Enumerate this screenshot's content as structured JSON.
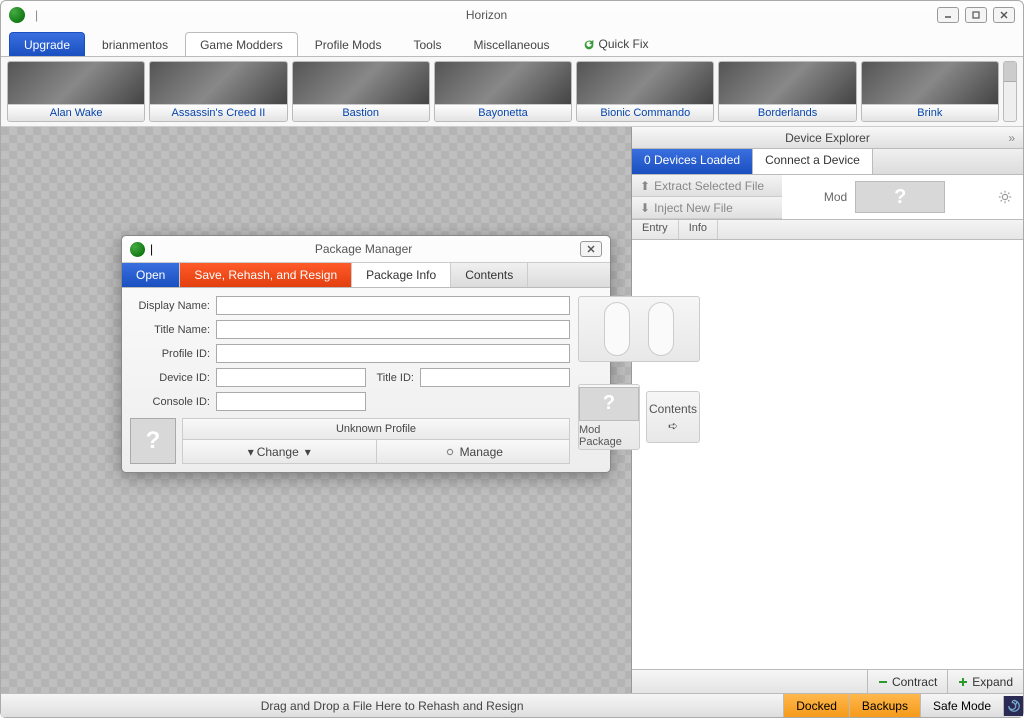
{
  "app": {
    "title": "Horizon"
  },
  "tabs": {
    "upgrade": "Upgrade",
    "items": [
      "brianmentos",
      "Game Modders",
      "Profile Mods",
      "Tools",
      "Miscellaneous"
    ],
    "active_index": 1,
    "quickfix": "Quick Fix"
  },
  "games": [
    "Alan Wake",
    "Assassin's Creed II",
    "Bastion",
    "Bayonetta",
    "Bionic Commando",
    "Borderlands",
    "Brink"
  ],
  "device_explorer": {
    "title": "Device Explorer",
    "tab_loaded": "0 Devices Loaded",
    "tab_connect": "Connect a Device",
    "extract": "Extract Selected File",
    "inject": "Inject New File",
    "mod": "Mod",
    "q": "?",
    "mini_tabs": [
      "Entry",
      "Info"
    ],
    "contract": "Contract",
    "expand": "Expand"
  },
  "pkg": {
    "title": "Package Manager",
    "tab_open": "Open",
    "tab_save": "Save, Rehash, and Resign",
    "tab_info": "Package Info",
    "tab_contents": "Contents",
    "labels": {
      "display_name": "Display Name:",
      "title_name": "Title Name:",
      "profile_id": "Profile ID:",
      "device_id": "Device ID:",
      "console_id": "Console ID:",
      "title_id": "Title ID:"
    },
    "values": {
      "display_name": "",
      "title_name": "",
      "profile_id": "",
      "device_id": "",
      "console_id": "",
      "title_id": ""
    },
    "unknown_profile": "Unknown Profile",
    "change": "Change",
    "manage": "Manage",
    "mod_package": "Mod Package",
    "contents_btn": "Contents",
    "q": "?"
  },
  "status": {
    "msg": "Drag and Drop a File Here to Rehash and Resign",
    "docked": "Docked",
    "backups": "Backups",
    "safe_mode": "Safe Mode"
  }
}
